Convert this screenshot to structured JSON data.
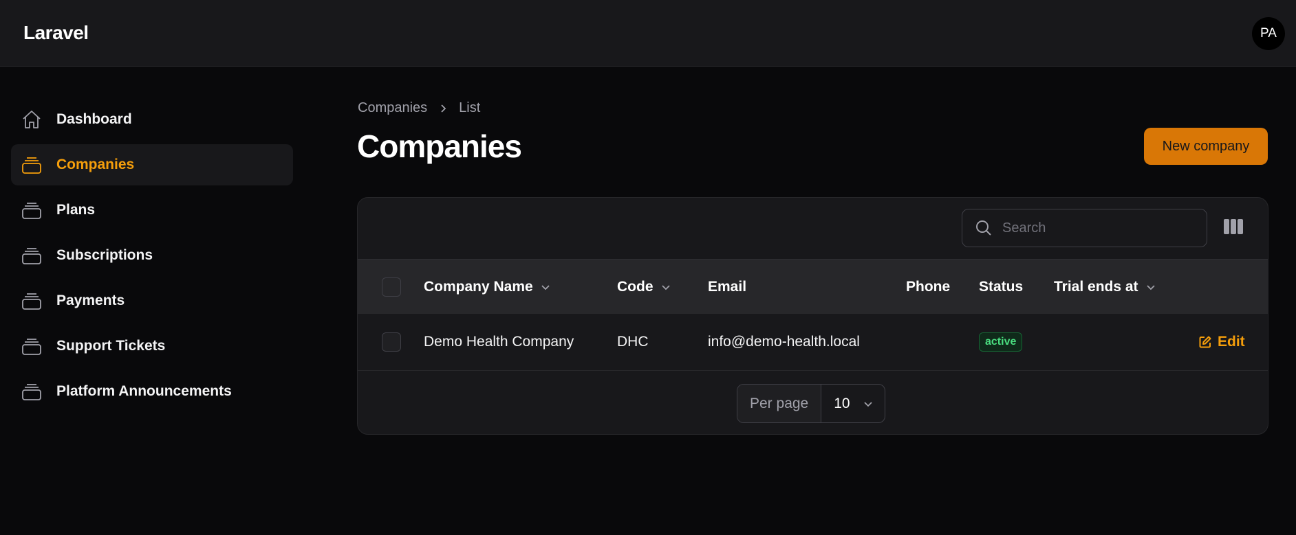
{
  "header": {
    "brand": "Laravel",
    "avatar_initials": "PA"
  },
  "sidebar": {
    "items": [
      {
        "label": "Dashboard",
        "icon": "home-icon",
        "active": false
      },
      {
        "label": "Companies",
        "icon": "stack-icon",
        "active": true
      },
      {
        "label": "Plans",
        "icon": "stack-icon",
        "active": false
      },
      {
        "label": "Subscriptions",
        "icon": "stack-icon",
        "active": false
      },
      {
        "label": "Payments",
        "icon": "stack-icon",
        "active": false
      },
      {
        "label": "Support Tickets",
        "icon": "stack-icon",
        "active": false
      },
      {
        "label": "Platform Announcements",
        "icon": "stack-icon",
        "active": false
      }
    ]
  },
  "breadcrumb": {
    "parent": "Companies",
    "current": "List"
  },
  "page": {
    "title": "Companies",
    "new_button": "New company"
  },
  "table": {
    "search_placeholder": "Search",
    "columns": {
      "company_name": "Company Name",
      "code": "Code",
      "email": "Email",
      "phone": "Phone",
      "status": "Status",
      "trial_ends_at": "Trial ends at"
    },
    "rows": [
      {
        "company_name": "Demo Health Company",
        "code": "DHC",
        "email": "info@demo-health.local",
        "phone": "",
        "status": "active",
        "trial_ends_at": "",
        "action": "Edit"
      }
    ],
    "pagination": {
      "per_page_label": "Per page",
      "per_page_value": "10"
    }
  },
  "colors": {
    "accent": "#f59e0b",
    "button": "#d97706",
    "success": "#4ade80"
  }
}
